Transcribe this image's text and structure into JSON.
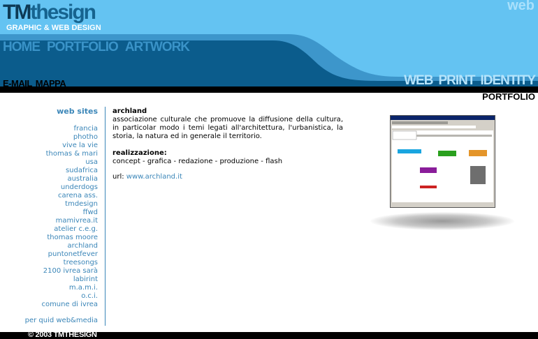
{
  "logo": {
    "mark": "TM",
    "text": "thesign",
    "tagline": "GRAPHIC & WEB DESIGN"
  },
  "corner_label": "web",
  "nav_main": [
    "HOME",
    "PORTFOLIO",
    "ARTWORK"
  ],
  "nav_secondary": [
    "E-MAIL",
    "MAPPA"
  ],
  "nav_services": [
    "WEB",
    "PRINT",
    "IDENTITY"
  ],
  "section_title": "PORTFOLIO",
  "sidebar": {
    "title": "web sites",
    "items": [
      "francia",
      "photho",
      "vive la vie",
      "thomas & mari",
      "usa",
      "sudafrica",
      "australia",
      "underdogs",
      "carena ass.",
      "tmdesign",
      "ffwd",
      "mamivrea.it",
      "atelier c.e.g.",
      "thomas moore",
      "archland",
      "puntonetfever",
      "treesongs",
      "2100 ivrea sarà",
      "labirint",
      "m.a.m.i.",
      "o.c.i.",
      "comune di ivrea"
    ],
    "footer_link": "per quid web&media"
  },
  "content": {
    "title": "archland",
    "description": "associazione culturale che promuove la diffusione della cultura, in particolar modo i temi legati all'architettura, l'urbanistica, la storia, la natura ed in generale il territorio.",
    "realization_label": "realizzazione:",
    "realization": "concept - grafica - redazione - produzione - flash",
    "url_label": "url: ",
    "url": "www.archland.it"
  },
  "footer": {
    "copyright": "© 2003 TMTHESIGN"
  },
  "colors": {
    "sky": "#64c3f2",
    "blue_mid": "#3a93c8",
    "blue_dark": "#0b5c8c",
    "link": "#3b86b8"
  }
}
